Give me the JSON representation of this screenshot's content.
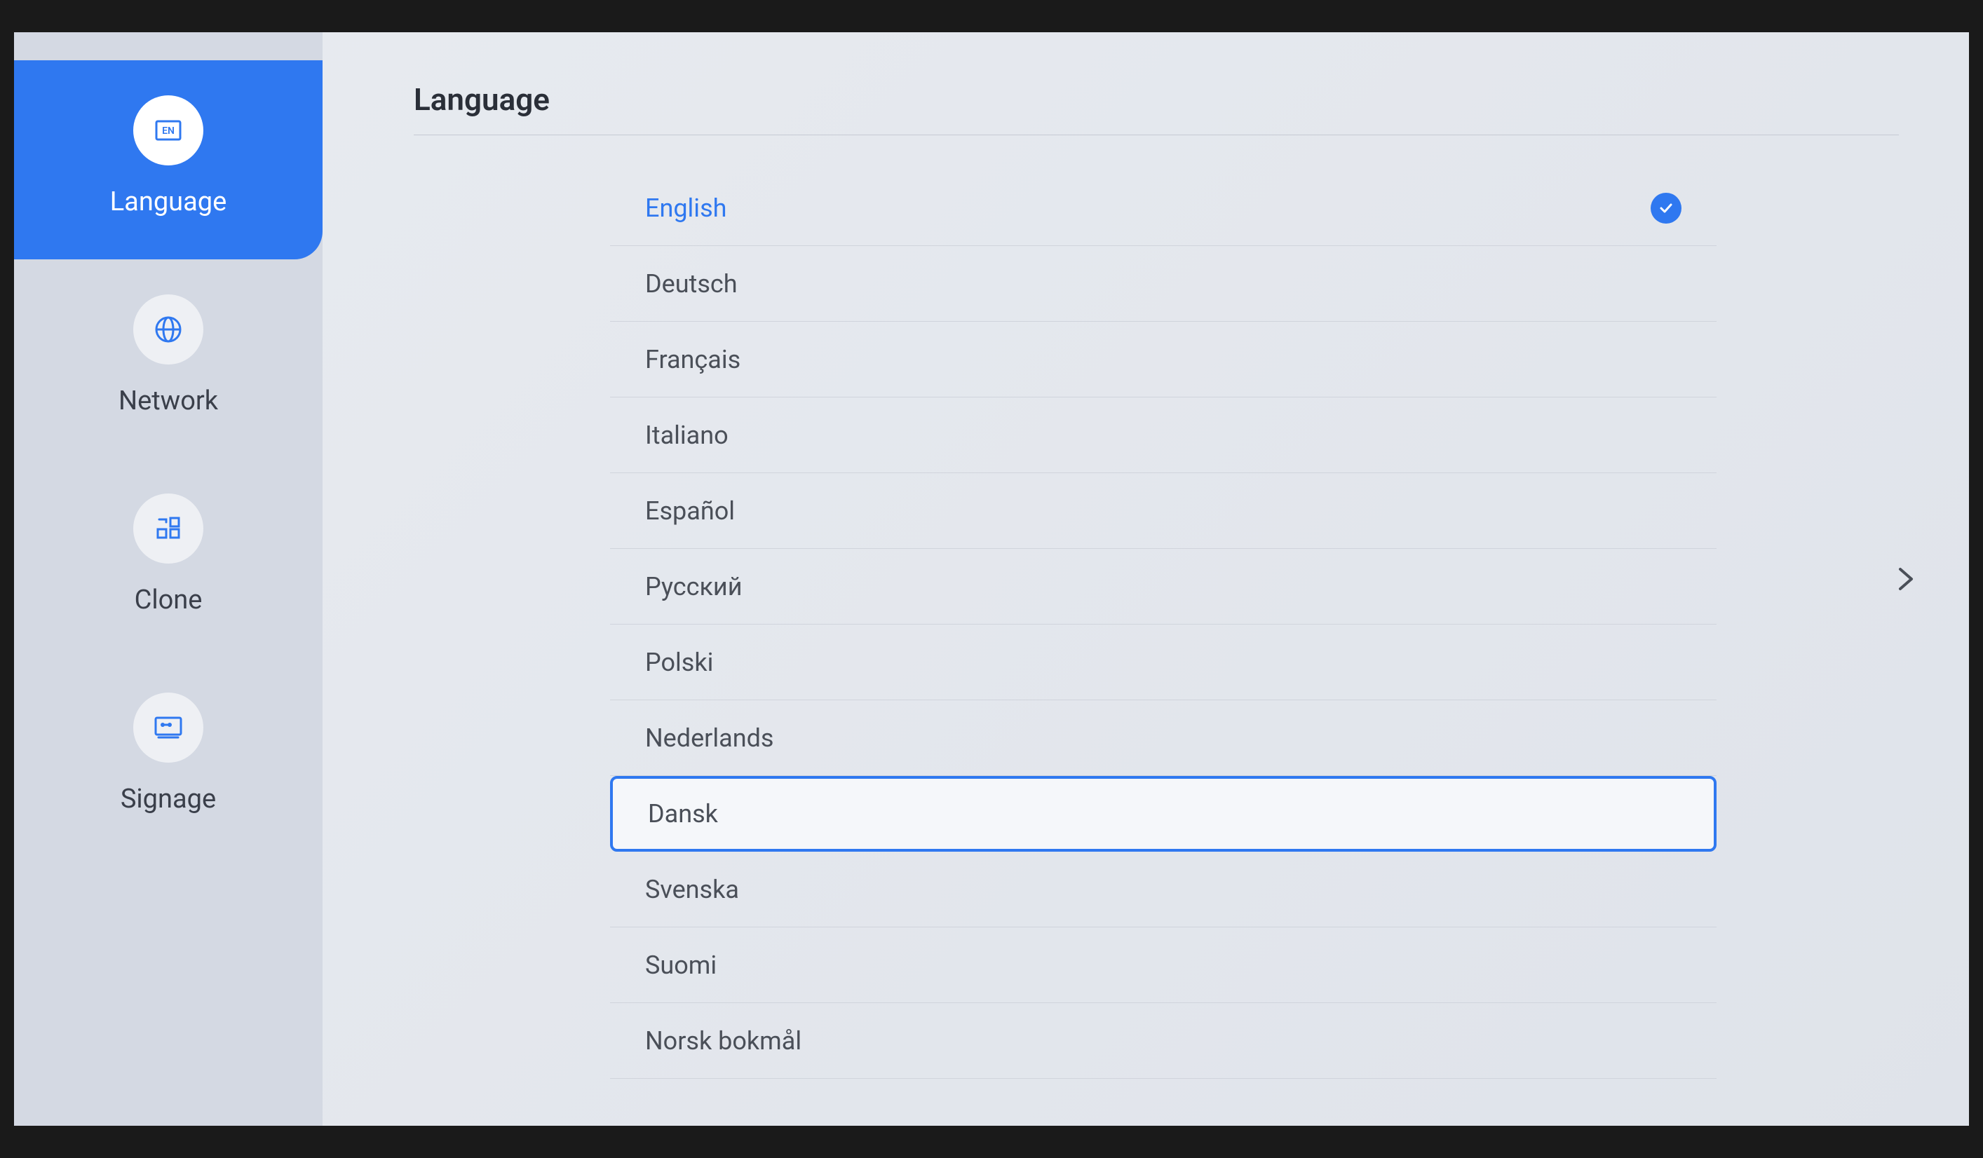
{
  "sidebar": {
    "items": [
      {
        "label": "Language",
        "icon": "language-en-icon",
        "active": true
      },
      {
        "label": "Network",
        "icon": "globe-icon",
        "active": false
      },
      {
        "label": "Clone",
        "icon": "clone-icon",
        "active": false
      },
      {
        "label": "Signage",
        "icon": "signage-icon",
        "active": false
      }
    ]
  },
  "page": {
    "title": "Language"
  },
  "languages": [
    {
      "label": "English",
      "selected": true,
      "focused": false
    },
    {
      "label": "Deutsch",
      "selected": false,
      "focused": false
    },
    {
      "label": "Français",
      "selected": false,
      "focused": false
    },
    {
      "label": "Italiano",
      "selected": false,
      "focused": false
    },
    {
      "label": "Español",
      "selected": false,
      "focused": false
    },
    {
      "label": "Русский",
      "selected": false,
      "focused": false
    },
    {
      "label": "Polski",
      "selected": false,
      "focused": false
    },
    {
      "label": "Nederlands",
      "selected": false,
      "focused": false
    },
    {
      "label": "Dansk",
      "selected": false,
      "focused": true
    },
    {
      "label": "Svenska",
      "selected": false,
      "focused": false
    },
    {
      "label": "Suomi",
      "selected": false,
      "focused": false
    },
    {
      "label": "Norsk bokmål",
      "selected": false,
      "focused": false
    }
  ],
  "colors": {
    "accent": "#2f78f0"
  }
}
